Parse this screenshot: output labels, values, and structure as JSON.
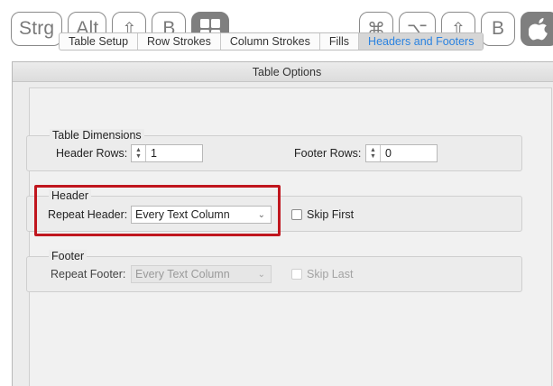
{
  "shortcut": {
    "windows": {
      "ctrl": "Strg",
      "alt": "Alt",
      "shift": "⇧",
      "key": "B"
    },
    "mac": {
      "cmd": "⌘",
      "option": "⌥",
      "shift": "⇧",
      "key": "B"
    }
  },
  "dialog": {
    "title": "Table Options",
    "tabs": [
      "Table Setup",
      "Row Strokes",
      "Column Strokes",
      "Fills",
      "Headers and Footers"
    ],
    "active_tab": "Headers and Footers",
    "table_dimensions": {
      "title": "Table Dimensions",
      "header_rows_label": "Header Rows:",
      "header_rows_value": "1",
      "footer_rows_label": "Footer Rows:",
      "footer_rows_value": "0"
    },
    "header": {
      "title": "Header",
      "repeat_label": "Repeat Header:",
      "repeat_value": "Every Text Column",
      "skip_label": "Skip First"
    },
    "footer": {
      "title": "Footer",
      "repeat_label": "Repeat Footer:",
      "repeat_value": "Every Text Column",
      "skip_label": "Skip Last"
    }
  },
  "colors": {
    "highlight": "#c0161e",
    "active_tab_text": "#2b83e0"
  }
}
